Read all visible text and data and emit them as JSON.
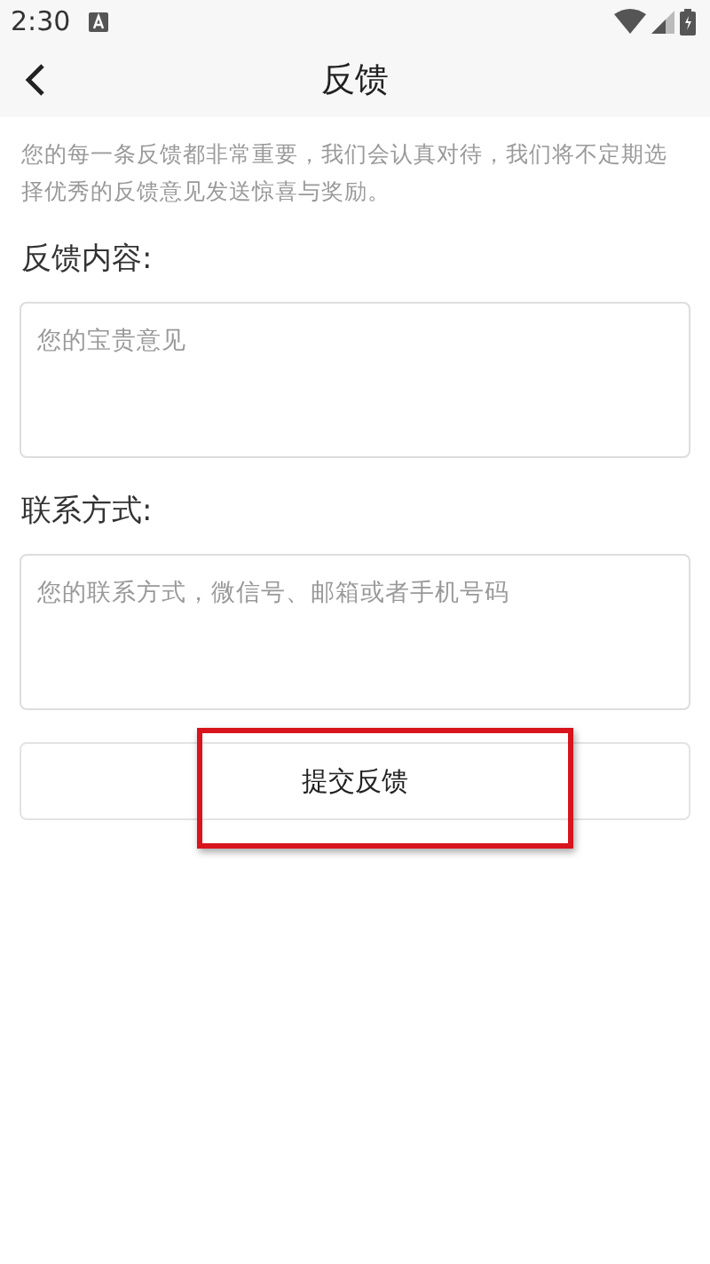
{
  "status_bar": {
    "time": "2:30"
  },
  "header": {
    "title": "反馈"
  },
  "intro": "您的每一条反馈都非常重要，我们会认真对待，我们将不定期选择优秀的反馈意见发送惊喜与奖励。",
  "fields": [
    {
      "label": "反馈内容:",
      "placeholder": "您的宝贵意见"
    },
    {
      "label": "联系方式:",
      "placeholder": "您的联系方式，微信号、邮箱或者手机号码"
    }
  ],
  "submit_button": {
    "label": "提交反馈",
    "highlighted": true
  }
}
